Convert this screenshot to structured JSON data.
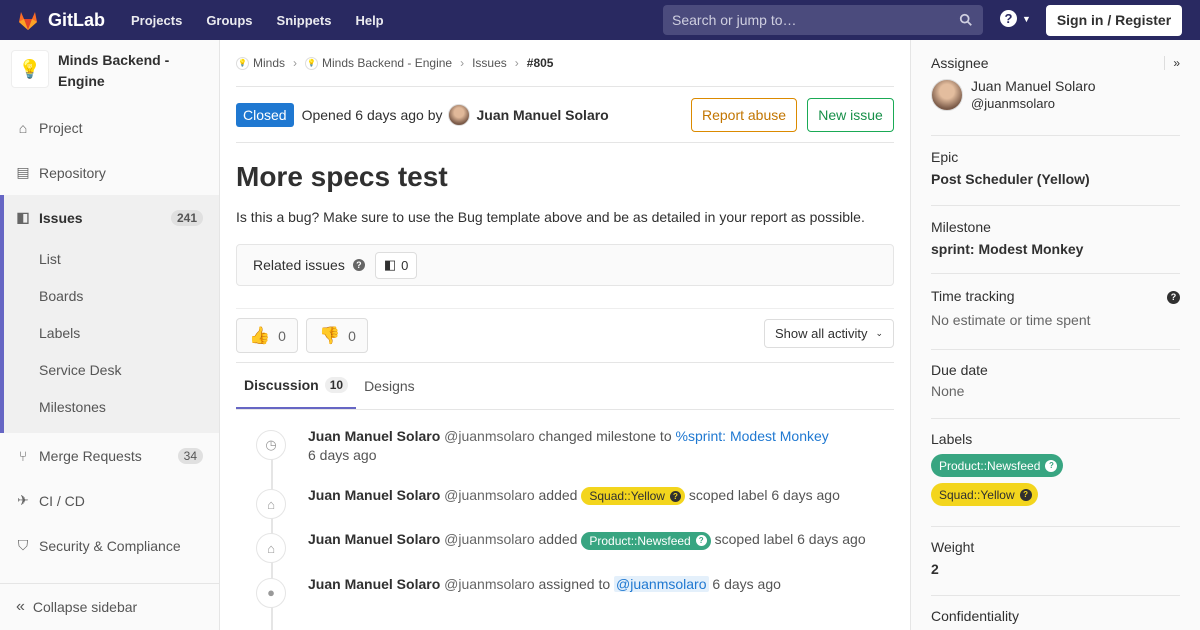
{
  "nav": {
    "brand": "GitLab",
    "links": [
      "Projects",
      "Groups",
      "Snippets",
      "Help"
    ],
    "search_placeholder": "Search or jump to…",
    "signin": "Sign in / Register"
  },
  "sidebar": {
    "project_name": "Minds Backend - Engine",
    "items": [
      {
        "label": "Project",
        "icon": "home-icon"
      },
      {
        "label": "Repository",
        "icon": "book-icon"
      }
    ],
    "issues": {
      "label": "Issues",
      "count": "241",
      "sub": [
        "List",
        "Boards",
        "Labels",
        "Service Desk",
        "Milestones"
      ]
    },
    "items2": [
      {
        "label": "Merge Requests",
        "count": "34",
        "icon": "merge-request-icon"
      },
      {
        "label": "CI / CD",
        "icon": "rocket-icon"
      },
      {
        "label": "Security & Compliance",
        "icon": "shield-icon"
      }
    ],
    "collapse": "Collapse sidebar"
  },
  "breadcrumb": [
    "Minds",
    "Minds Backend - Engine",
    "Issues",
    "#805"
  ],
  "issue": {
    "status": "Closed",
    "opened_text": "Opened 6 days ago by",
    "author": "Juan Manuel Solaro",
    "report_abuse": "Report abuse",
    "new_issue": "New issue",
    "title": "More specs test",
    "description": "Is this a bug? Make sure to use the Bug template above and be as detailed in your report as possible.",
    "related_label": "Related issues",
    "related_count": "0",
    "thumbs_up": "0",
    "thumbs_down": "0",
    "show_activity": "Show all activity",
    "tabs": [
      {
        "label": "Discussion",
        "count": "10"
      },
      {
        "label": "Designs"
      }
    ]
  },
  "notes": [
    {
      "name": "Juan Manuel Solaro",
      "handle": "@juanmsolaro",
      "action": "changed milestone to",
      "link": "%sprint: Modest Monkey",
      "time": "6 days ago",
      "icon": "clock-icon"
    },
    {
      "name": "Juan Manuel Solaro",
      "handle": "@juanmsolaro",
      "action": "added",
      "label": "Squad::Yellow",
      "after": "scoped label 6 days ago",
      "icon": "tag-icon"
    },
    {
      "name": "Juan Manuel Solaro",
      "handle": "@juanmsolaro",
      "action": "added",
      "label": "Product::Newsfeed",
      "after": "scoped label 6 days ago",
      "icon": "tag-icon"
    },
    {
      "name": "Juan Manuel Solaro",
      "handle": "@juanmsolaro",
      "action": "assigned to",
      "mention": "@juanmsolaro",
      "after": "6 days ago",
      "icon": "user-icon"
    }
  ],
  "right": {
    "assignee_title": "Assignee",
    "assignee_name": "Juan Manuel Solaro",
    "assignee_handle": "@juanmsolaro",
    "epic_title": "Epic",
    "epic_value": "Post Scheduler (Yellow)",
    "milestone_title": "Milestone",
    "milestone_value": "sprint: Modest Monkey",
    "time_title": "Time tracking",
    "time_value": "No estimate or time spent",
    "due_title": "Due date",
    "due_value": "None",
    "labels_title": "Labels",
    "labels": [
      "Product::Newsfeed",
      "Squad::Yellow"
    ],
    "weight_title": "Weight",
    "weight_value": "2",
    "confidentiality_title": "Confidentiality"
  },
  "colors": {
    "nav": "#292961",
    "closed": "#1f78d1",
    "yellow_label": "#f3d51d",
    "green_label": "#38a581",
    "active_accent": "#6666c4"
  }
}
